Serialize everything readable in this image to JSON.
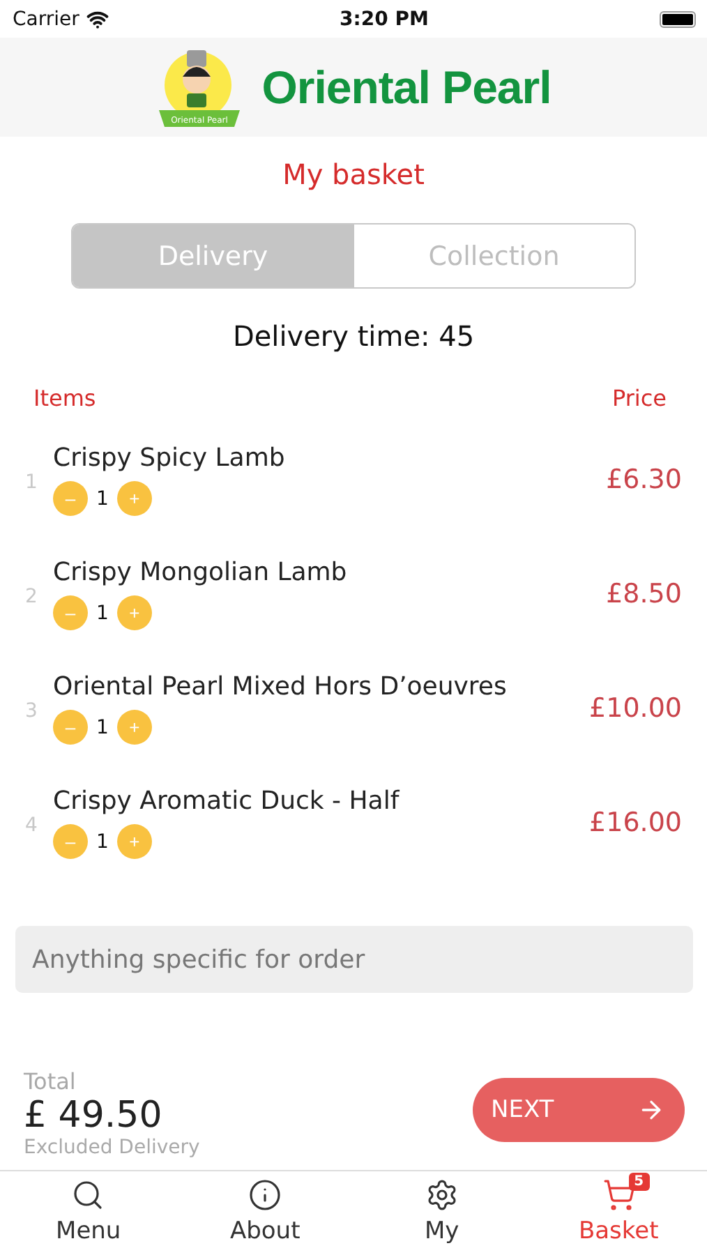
{
  "status_bar": {
    "carrier": "Carrier",
    "time": "3:20 PM"
  },
  "header": {
    "brand": "Oriental Pearl",
    "ribbon": "Oriental Pearl"
  },
  "title": "My basket",
  "order_type": [
    {
      "label": "Delivery",
      "selected": true
    },
    {
      "label": "Collection",
      "selected": false
    }
  ],
  "delivery_time": "Delivery time: 45",
  "columns": {
    "items": "Items",
    "price": "Price"
  },
  "items": [
    {
      "index": "1",
      "name": "Crispy Spicy Lamb",
      "quantity": "1",
      "minus": "–",
      "plus": "+",
      "price": "£6.30"
    },
    {
      "index": "2",
      "name": "Crispy Mongolian Lamb",
      "quantity": "1",
      "minus": "–",
      "plus": "+",
      "price": "£8.50"
    },
    {
      "index": "3",
      "name": "Oriental Pearl Mixed Hors D’oeuvres",
      "quantity": "1",
      "minus": "–",
      "plus": "+",
      "price": "£10.00"
    },
    {
      "index": "4",
      "name": "Crispy Aromatic Duck - Half",
      "quantity": "1",
      "minus": "–",
      "plus": "+",
      "price": "£16.00"
    }
  ],
  "note": {
    "placeholder": "Anything specific for order"
  },
  "total": {
    "label": "Total",
    "amount": "£ 49.50",
    "note": "Excluded Delivery"
  },
  "next_button": {
    "label": "NEXT"
  },
  "tab_bar": [
    {
      "kind": "search",
      "label": "Menu",
      "selected": false
    },
    {
      "kind": "info",
      "label": "About",
      "selected": false
    },
    {
      "kind": "settings",
      "label": "My",
      "selected": false
    },
    {
      "kind": "cart",
      "label": "Basket",
      "selected": true,
      "badge": "5"
    }
  ]
}
